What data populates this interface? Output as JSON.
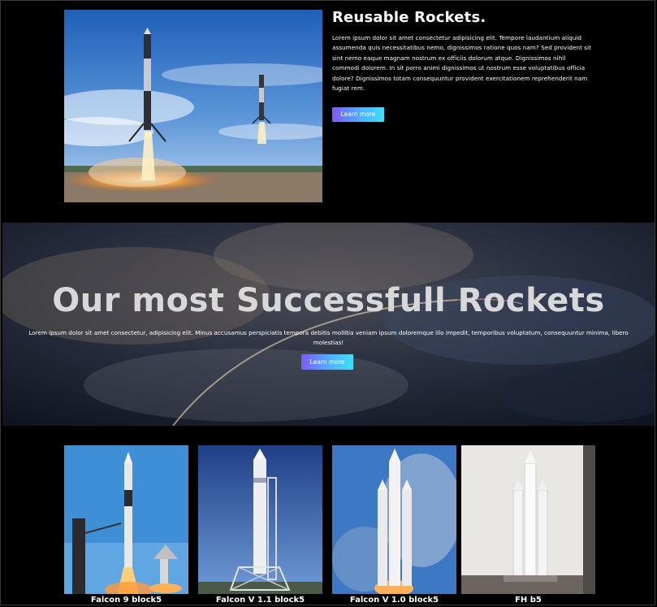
{
  "feature": {
    "title": "Reusable Rockets.",
    "text": "Lorem ipsum dolor sit amet consectetur adipisicing elit. Tempore laudantium aliquid assumenda quis necessitatibus nemo, dignissimos ratione quos nam? Sed provident sit sint nemo eaque magnam nostrum ex officiis dolorum atque. Dignissimos nihil commodi dolorem. In sit porro animi dignissimos ut nostrum esse voluptatibus officia dolore? Dignissimos totam consequuntur provident exercitationem reprehenderit nam fugiat rem.",
    "button_label": "Learn more"
  },
  "hero": {
    "title": "Our most Successfull Rockets",
    "text": "Lorem ipsum dolor sit amet consectetur, adipisicing elit. Minus accusamus perspiciatis tempora debitis mollitia veniam ipsum doloremque illo impedit, temporibus voluptatum, consequuntur minima, libero molestias!",
    "button_label": "Learn more"
  },
  "gallery": {
    "items": [
      {
        "caption": "Falcon 9 block5"
      },
      {
        "caption": "Falcon V 1.1 block5"
      },
      {
        "caption": "Falcon V 1.0 block5"
      },
      {
        "caption": "FH b5"
      }
    ]
  },
  "colors": {
    "background": "#000000",
    "button_gradient_start": "#7b5cff",
    "button_gradient_end": "#3ee0ff",
    "hero_title": "#d8d8d8"
  }
}
